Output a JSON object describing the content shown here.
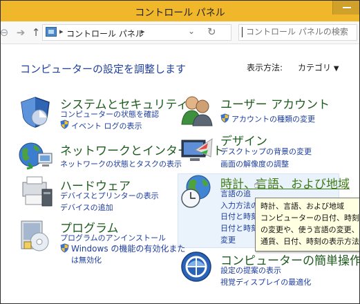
{
  "window": {
    "title": "コントロール パネル"
  },
  "toolbar": {
    "back_icon": "back-arrow-icon",
    "forward_icon": "forward-arrow-icon",
    "up_icon": "up-arrow-icon",
    "breadcrumb": "コントロール パネル",
    "refresh_icon": "refresh-icon",
    "search_placeholder": "コントロール パネルの検索"
  },
  "header": {
    "title": "コンピューターの設定を調整します",
    "view_by_label": "表示方法:",
    "view_by_value": "カテゴリ"
  },
  "categories": {
    "system": {
      "title": "システムとセキュリティ",
      "links": [
        "コンピューターの状態を確認",
        "イベント ログの表示"
      ]
    },
    "network": {
      "title": "ネットワークとインターネット",
      "links": [
        "ネットワークの状態とタスクの表示"
      ]
    },
    "hardware": {
      "title": "ハードウェア",
      "links": [
        "デバイスとプリンターの表示",
        "デバイスの追加"
      ]
    },
    "programs": {
      "title": "プログラム",
      "links": [
        "プログラムのアンインストール",
        "Windows の機能の有効化また",
        "は無効化"
      ]
    },
    "user": {
      "title": "ユーザー アカウント",
      "links": [
        "アカウントの種類の変更"
      ]
    },
    "design": {
      "title": "デザイン",
      "links": [
        "デスクトップの背景の変更",
        "画面の解像度の調整"
      ]
    },
    "clock": {
      "title": "時計、言語、および地域",
      "links": [
        "言語の追",
        "入力方法の",
        "日付と時刻",
        "日付と時刻",
        "変更"
      ]
    },
    "ease": {
      "title": "コンピューターの簡単操作",
      "links": [
        "設定の提案の表示",
        "視覚ディスプレイの最適化"
      ]
    }
  },
  "tooltip": {
    "lines": [
      "時計、言語、および地域",
      "コンピューターの日付、時刻、タ",
      "の変更や、使う言語の変更、お",
      "通貨、日付、時刻の表示方法"
    ]
  },
  "colors": {
    "titlebar": "#f0b72a",
    "category_title": "#1e5c1e",
    "link": "#1d3d9e",
    "page_title": "#1f3f9f"
  }
}
